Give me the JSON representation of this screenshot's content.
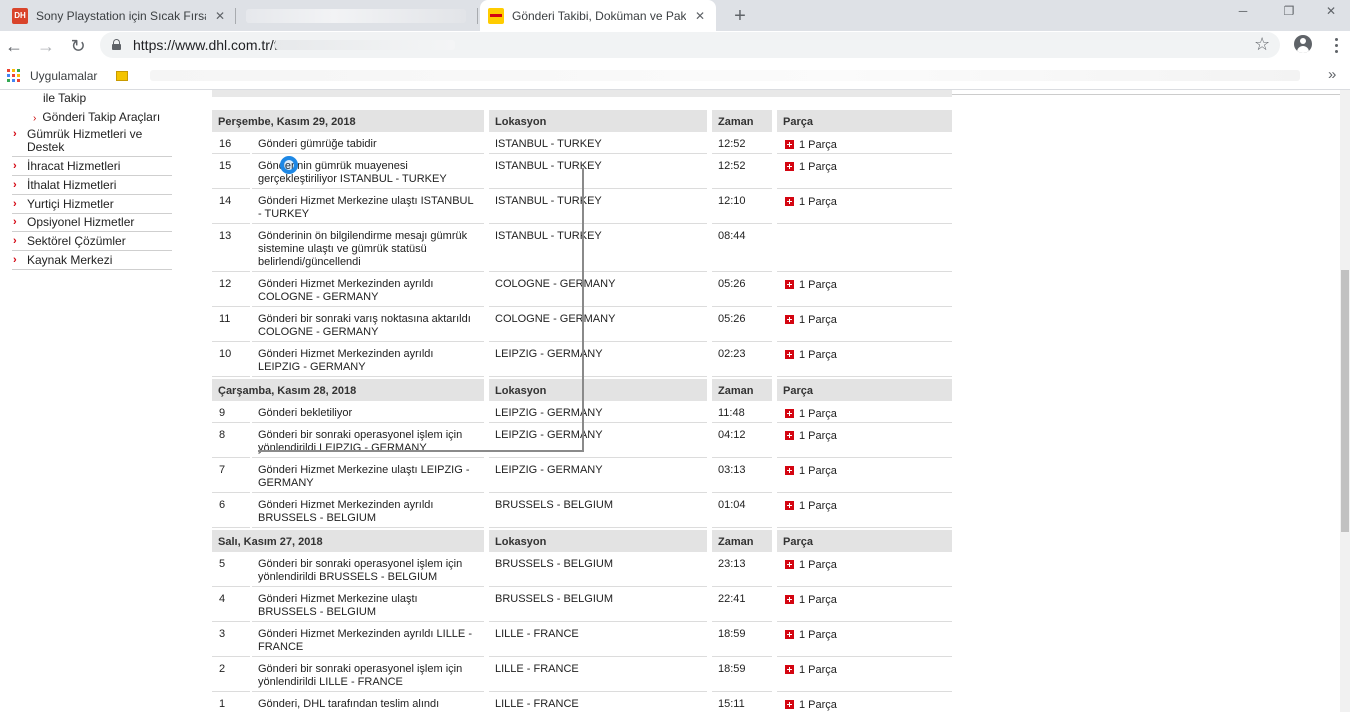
{
  "browser": {
    "tabs": [
      {
        "title": "Sony Playstation için Sıcak Fırsatla",
        "icon": "dh-logo-icon",
        "active": false
      },
      {
        "title": "",
        "icon": "",
        "active": false
      },
      {
        "title": "Gönderi Takibi, Doküman ve Paket",
        "icon": "dhl-logo-icon",
        "active": true
      }
    ],
    "new_tab": "+",
    "url": "https://www.dhl.com.tr/t...",
    "bookmarks": {
      "apps_label": "Uygulamalar"
    }
  },
  "sidebar": {
    "sub_items": [
      "ile Takip",
      "Gönderi Takip Araçları"
    ],
    "items": [
      "Gümrük Hizmetleri ve Destek",
      "İhracat Hizmetleri",
      "İthalat Hizmetleri",
      "Yurtiçi Hizmetler",
      "Opsiyonel Hizmetler",
      "Sektörel Çözümler",
      "Kaynak Merkezi"
    ]
  },
  "table": {
    "columns": {
      "location": "Lokasyon",
      "time": "Zaman",
      "pieces": "Parça"
    },
    "piece_label": "1 Parça",
    "groups": [
      {
        "date": "Perşembe, Kasım 29, 2018",
        "events": [
          {
            "no": "16",
            "desc": "Gönderi gümrüğe tabidir",
            "loc": "ISTANBUL - TURKEY",
            "time": "12:52",
            "piece": true
          },
          {
            "no": "15",
            "desc": "Gönderinin gümrük muayenesi gerçekleştiriliyor ISTANBUL - TURKEY",
            "loc": "ISTANBUL - TURKEY",
            "time": "12:52",
            "piece": true
          },
          {
            "no": "14",
            "desc": "Gönderi Hizmet Merkezine ulaştı ISTANBUL - TURKEY",
            "loc": "ISTANBUL - TURKEY",
            "time": "12:10",
            "piece": true
          },
          {
            "no": "13",
            "desc": "Gönderinin ön bilgilendirme mesajı gümrük sistemine ulaştı ve gümrük statüsü belirlendi/güncellendi",
            "loc": "ISTANBUL - TURKEY",
            "time": "08:44",
            "piece": false
          },
          {
            "no": "12",
            "desc": "Gönderi Hizmet Merkezinden ayrıldı COLOGNE - GERMANY",
            "loc": "COLOGNE - GERMANY",
            "time": "05:26",
            "piece": true
          },
          {
            "no": "11",
            "desc": "Gönderi bir sonraki varış noktasına aktarıldı COLOGNE - GERMANY",
            "loc": "COLOGNE - GERMANY",
            "time": "05:26",
            "piece": true
          },
          {
            "no": "10",
            "desc": "Gönderi Hizmet Merkezinden ayrıldı LEIPZIG - GERMANY",
            "loc": "LEIPZIG - GERMANY",
            "time": "02:23",
            "piece": true
          }
        ]
      },
      {
        "date": "Çarşamba, Kasım 28, 2018",
        "events": [
          {
            "no": "9",
            "desc": "Gönderi bekletiliyor",
            "loc": "LEIPZIG - GERMANY",
            "time": "11:48",
            "piece": true
          },
          {
            "no": "8",
            "desc": "Gönderi bir sonraki operasyonel işlem için yönlendirildi LEIPZIG - GERMANY",
            "loc": "LEIPZIG - GERMANY",
            "time": "04:12",
            "piece": true
          },
          {
            "no": "7",
            "desc": "Gönderi Hizmet Merkezine ulaştı LEIPZIG - GERMANY",
            "loc": "LEIPZIG - GERMANY",
            "time": "03:13",
            "piece": true
          },
          {
            "no": "6",
            "desc": "Gönderi Hizmet Merkezinden ayrıldı BRUSSELS - BELGIUM",
            "loc": "BRUSSELS - BELGIUM",
            "time": "01:04",
            "piece": true
          }
        ]
      },
      {
        "date": "Salı, Kasım 27, 2018",
        "events": [
          {
            "no": "5",
            "desc": "Gönderi bir sonraki operasyonel işlem için yönlendirildi BRUSSELS - BELGIUM",
            "loc": "BRUSSELS - BELGIUM",
            "time": "23:13",
            "piece": true
          },
          {
            "no": "4",
            "desc": "Gönderi Hizmet Merkezine ulaştı BRUSSELS - BELGIUM",
            "loc": "BRUSSELS - BELGIUM",
            "time": "22:41",
            "piece": true
          },
          {
            "no": "3",
            "desc": "Gönderi Hizmet Merkezinden ayrıldı LILLE - FRANCE",
            "loc": "LILLE - FRANCE",
            "time": "18:59",
            "piece": true
          },
          {
            "no": "2",
            "desc": "Gönderi bir sonraki operasyonel işlem için yönlendirildi LILLE - FRANCE",
            "loc": "LILLE - FRANCE",
            "time": "18:59",
            "piece": true
          },
          {
            "no": "1",
            "desc": "Gönderi, DHL tarafından teslim alındı",
            "loc": "LILLE - FRANCE",
            "time": "15:11",
            "piece": true
          }
        ]
      }
    ]
  },
  "colors": {
    "dhl_red": "#d40511",
    "dhl_yellow": "#ffcc00",
    "header_gray": "#e3e3e3"
  }
}
